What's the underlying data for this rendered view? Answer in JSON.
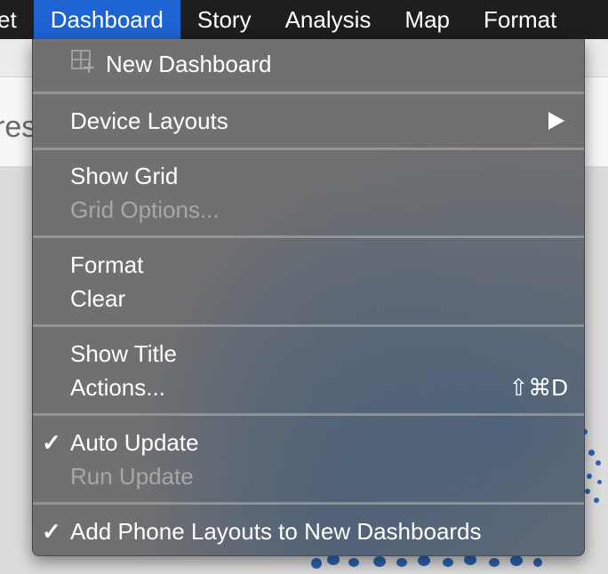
{
  "menubar": {
    "items": [
      {
        "label": "et",
        "active": false
      },
      {
        "label": "Dashboard",
        "active": true
      },
      {
        "label": "Story",
        "active": false
      },
      {
        "label": "Analysis",
        "active": false
      },
      {
        "label": "Map",
        "active": false
      },
      {
        "label": "Format",
        "active": false
      }
    ]
  },
  "background": {
    "sheet_title_fragment": "res"
  },
  "dashboard_menu": {
    "new_dashboard": {
      "label": "New Dashboard",
      "icon": "new-dashboard-icon"
    },
    "device_layouts": {
      "label": "Device Layouts",
      "submenu_icon": "submenu-arrow-icon"
    },
    "show_grid": {
      "label": "Show Grid"
    },
    "grid_options": {
      "label": "Grid Options...",
      "enabled": false
    },
    "format": {
      "label": "Format"
    },
    "clear": {
      "label": "Clear"
    },
    "show_title": {
      "label": "Show Title"
    },
    "actions": {
      "label": "Actions...",
      "shortcut": "⇧⌘D"
    },
    "auto_update": {
      "label": "Auto Update",
      "checked": true,
      "check": "✓"
    },
    "run_update": {
      "label": "Run Update",
      "enabled": false
    },
    "add_phone_layouts": {
      "label": "Add Phone Layouts to New Dashboards",
      "checked": true,
      "check": "✓"
    }
  },
  "colors": {
    "menubar_bg": "#1e1e1e",
    "active_menu": "#1e63d2",
    "menu_bg": "#707070",
    "disabled_text": "#a7a7a7",
    "map_marks": "#2f63b0"
  }
}
